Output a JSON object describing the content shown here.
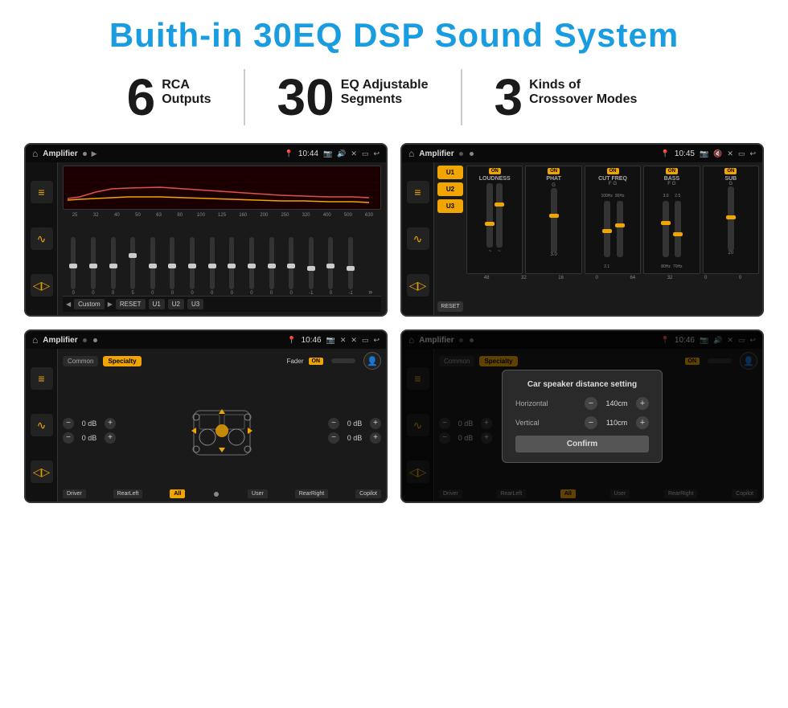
{
  "page": {
    "title": "Buith-in 30EQ DSP Sound System",
    "background": "#ffffff"
  },
  "stats": {
    "items": [
      {
        "number": "6",
        "line1": "RCA",
        "line2": "Outputs"
      },
      {
        "number": "30",
        "line1": "EQ Adjustable",
        "line2": "Segments"
      },
      {
        "number": "3",
        "line1": "Kinds of",
        "line2": "Crossover Modes"
      }
    ]
  },
  "screens": {
    "screen1": {
      "status": {
        "app": "Amplifier",
        "time": "10:44"
      },
      "eq_freqs": [
        "25",
        "32",
        "40",
        "50",
        "63",
        "80",
        "100",
        "125",
        "160",
        "200",
        "250",
        "320",
        "400",
        "500",
        "630"
      ],
      "eq_values": [
        "0",
        "0",
        "0",
        "5",
        "0",
        "0",
        "0",
        "0",
        "0",
        "0",
        "0",
        "0",
        "-1",
        "0",
        "-1"
      ],
      "bottom_btns": [
        "Custom",
        "RESET",
        "U1",
        "U2",
        "U3"
      ]
    },
    "screen2": {
      "status": {
        "app": "Amplifier",
        "time": "10:45"
      },
      "presets": [
        "U1",
        "U2",
        "U3"
      ],
      "controls": [
        "LOUDNESS",
        "PHAT",
        "CUT FREQ",
        "BASS",
        "SUB"
      ],
      "reset_label": "RESET"
    },
    "screen3": {
      "status": {
        "app": "Amplifier",
        "time": "10:46"
      },
      "tabs": [
        "Common",
        "Specialty"
      ],
      "fader_label": "Fader",
      "fader_on": "ON",
      "dB_values": [
        "0 dB",
        "0 dB",
        "0 dB",
        "0 dB"
      ],
      "bottom_btns": [
        "Driver",
        "RearLeft",
        "All",
        "User",
        "RearRight",
        "Copilot"
      ]
    },
    "screen4": {
      "status": {
        "app": "Amplifier",
        "time": "10:46"
      },
      "tabs": [
        "Common",
        "Specialty"
      ],
      "dialog": {
        "title": "Car speaker distance setting",
        "horizontal_label": "Horizontal",
        "horizontal_value": "140cm",
        "vertical_label": "Vertical",
        "vertical_value": "110cm",
        "confirm_label": "Confirm"
      },
      "dB_values": [
        "0 dB",
        "0 dB"
      ],
      "bottom_btns": [
        "Driver",
        "RearLeft",
        "All",
        "User",
        "RearRight",
        "Copilot"
      ]
    }
  }
}
